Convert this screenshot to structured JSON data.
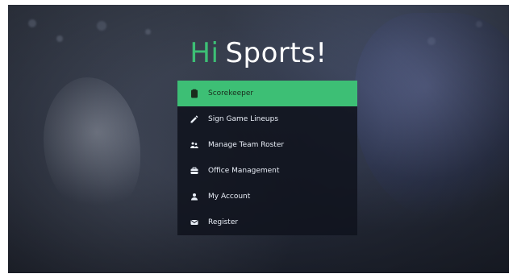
{
  "brand": {
    "part1": "Hi",
    "part2": "Sports!",
    "accent_color": "#3dbf75"
  },
  "menu": {
    "active_index": 0,
    "items": [
      {
        "label": "Scorekeeper",
        "icon": "clipboard-icon"
      },
      {
        "label": "Sign Game Lineups",
        "icon": "pencil-icon"
      },
      {
        "label": "Manage Team Roster",
        "icon": "users-icon"
      },
      {
        "label": "Office Management",
        "icon": "briefcase-icon"
      },
      {
        "label": "My Account",
        "icon": "user-icon"
      },
      {
        "label": "Register",
        "icon": "envelope-icon"
      }
    ]
  }
}
